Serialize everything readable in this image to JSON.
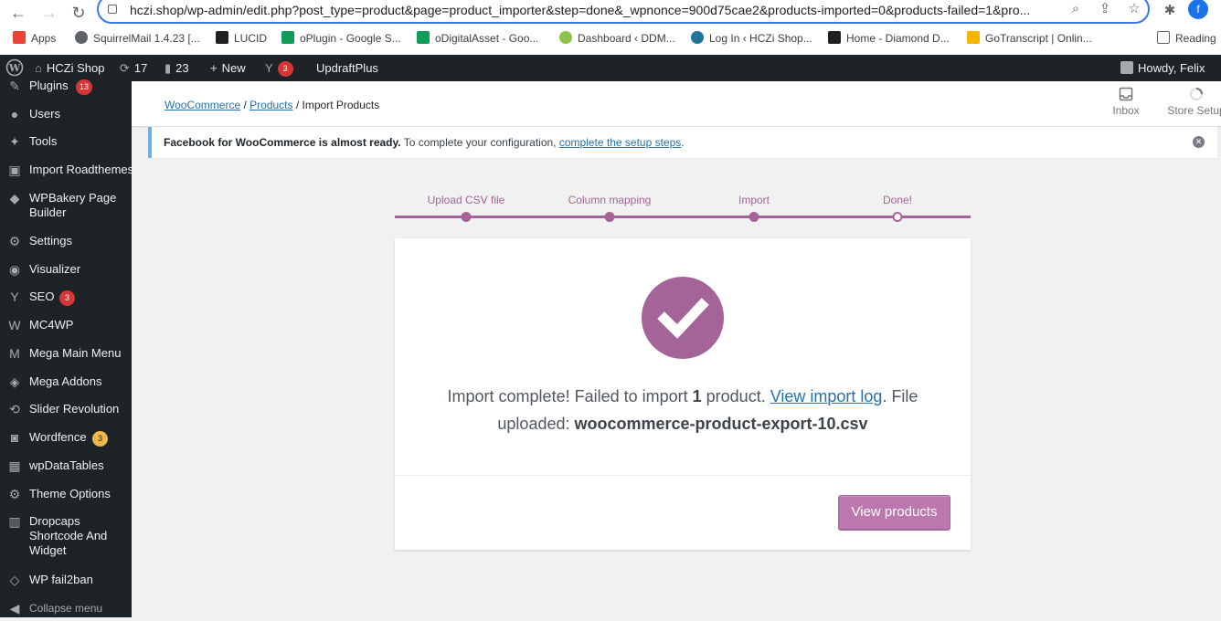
{
  "browser": {
    "url": "hczi.shop/wp-admin/edit.php?post_type=product&page=product_importer&step=done&_wpnonce=900d75cae2&products-imported=0&products-failed=1&pro...",
    "profile_initial": "f",
    "bookmarks": [
      {
        "label": "Apps",
        "color": "#ea4335"
      },
      {
        "label": "SquirrelMail 1.4.23 [...",
        "color": "#5f6368"
      },
      {
        "label": "LUCID",
        "color": "#202124"
      },
      {
        "label": "oPlugin - Google S...",
        "color": "#0f9d58"
      },
      {
        "label": "oDigitalAsset - Goo...",
        "color": "#0f9d58"
      },
      {
        "label": "Dashboard ‹ DDM...",
        "color": "#8bc34a"
      },
      {
        "label": "Log In ‹ HCZi Shop...",
        "color": "#21759b"
      },
      {
        "label": "Home - Diamond D...",
        "color": "#202124"
      },
      {
        "label": "GoTranscript | Onlin...",
        "color": "#f4b400"
      }
    ],
    "reading_list": "Reading"
  },
  "adminbar": {
    "site_name": "HCZi Shop",
    "updates_count": "17",
    "comments_count": "23",
    "new_label": "New",
    "seo_count": "3",
    "updraft_label": "UpdraftPlus",
    "howdy": "Howdy, Felix"
  },
  "sidebar": {
    "items": [
      {
        "label": "Plugins",
        "badge": "13"
      },
      {
        "label": "Users"
      },
      {
        "label": "Tools"
      },
      {
        "label": "Import Roadthemes"
      },
      {
        "label": "WPBakery Page Builder"
      },
      {
        "label": "Settings"
      },
      {
        "label": "Visualizer"
      },
      {
        "label": "SEO",
        "badge": "3"
      },
      {
        "label": "MC4WP"
      },
      {
        "label": "Mega Main Menu"
      },
      {
        "label": "Mega Addons"
      },
      {
        "label": "Slider Revolution"
      },
      {
        "label": "Wordfence",
        "badge": "3"
      },
      {
        "label": "wpDataTables"
      },
      {
        "label": "Theme Options"
      },
      {
        "label": "Dropcaps Shortcode And Widget"
      },
      {
        "label": "WP fail2ban"
      },
      {
        "label": "Collapse menu"
      }
    ]
  },
  "header": {
    "breadcrumb": [
      "WooCommerce",
      "Products",
      "Import Products"
    ],
    "inbox_label": "Inbox",
    "store_setup_label": "Store Setup"
  },
  "notice": {
    "strong": "Facebook for WooCommerce is almost ready.",
    "text": " To complete your configuration, ",
    "link": "complete the setup steps",
    "end": "."
  },
  "steps": [
    "Upload CSV file",
    "Column mapping",
    "Import",
    "Done!"
  ],
  "result": {
    "prefix": "Import complete! Failed to import ",
    "count": "1",
    "middle": " product. ",
    "log_link": "View import log",
    "file_prefix": ". File uploaded: ",
    "file_name": "woocommerce-product-export-10.csv",
    "button": "View products"
  },
  "colors": {
    "woo_purple": "#a46497",
    "admin_dark": "#1d2327",
    "link_blue": "#2271b1"
  }
}
